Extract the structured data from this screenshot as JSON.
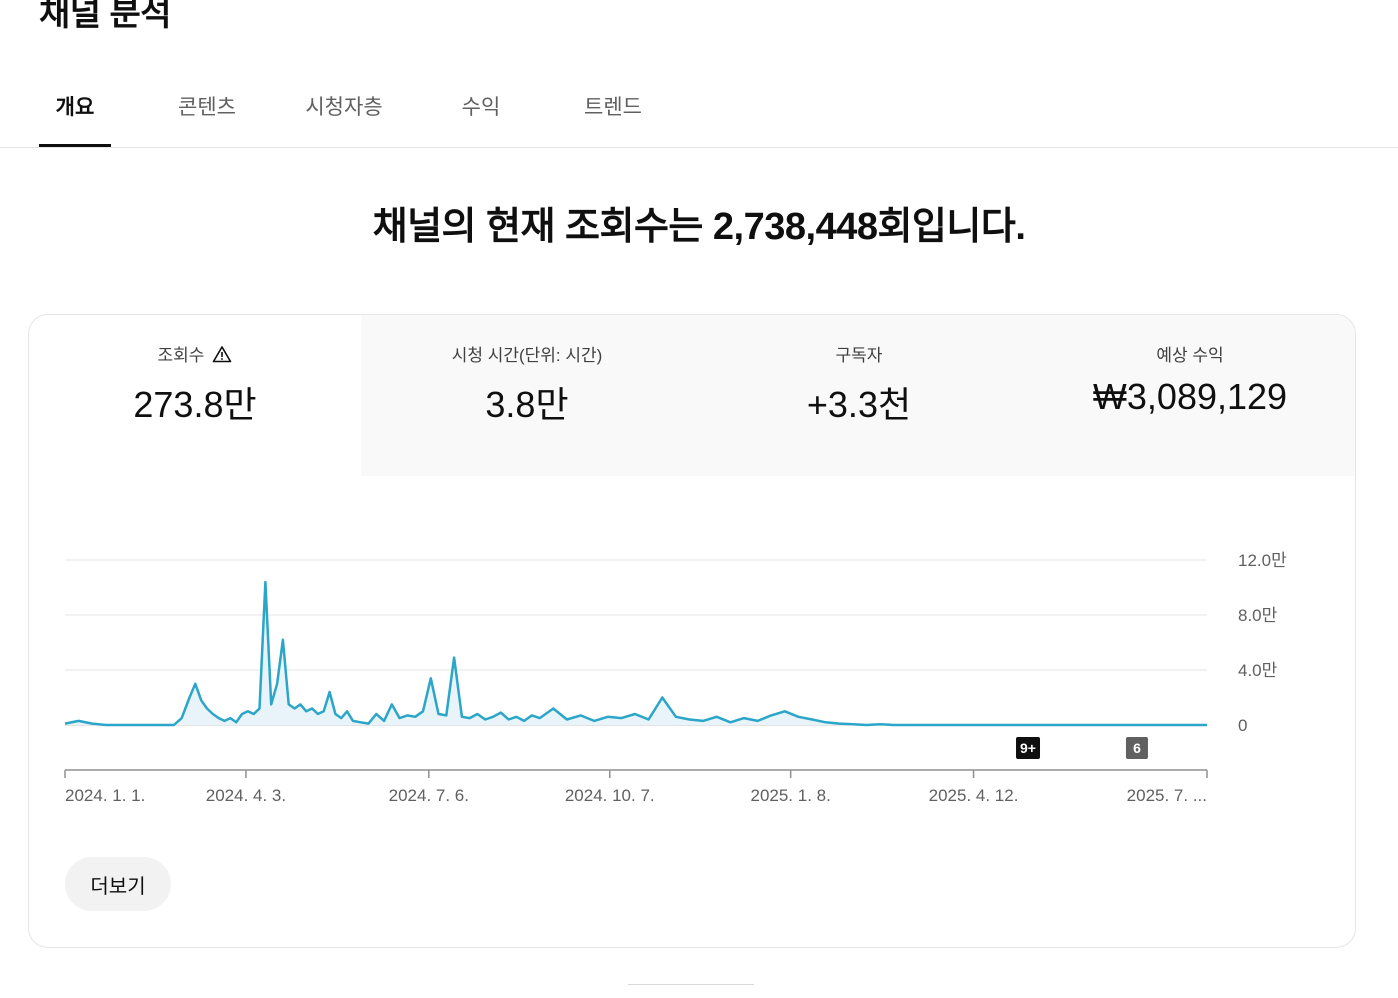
{
  "page_title": "채널 분석",
  "tabs": [
    {
      "label": "개요",
      "active": true
    },
    {
      "label": "콘텐츠",
      "active": false
    },
    {
      "label": "시청자층",
      "active": false
    },
    {
      "label": "수익",
      "active": false
    },
    {
      "label": "트렌드",
      "active": false
    }
  ],
  "headline": "채널의 현재 조회수는 2,738,448회입니다.",
  "metrics": [
    {
      "label": "조회수",
      "value": "273.8만",
      "icon": "warning-icon",
      "active": true
    },
    {
      "label": "시청 시간(단위: 시간)",
      "value": "3.8만",
      "active": false
    },
    {
      "label": "구독자",
      "value": "+3.3천",
      "active": false
    },
    {
      "label": "예상 수익",
      "value": "₩3,089,129",
      "active": false
    }
  ],
  "more_button": "더보기",
  "colors": {
    "line": "#2ba5c8",
    "fill": "#e8f4f9",
    "active_tab": "#0f0f0f"
  },
  "chart_data": {
    "type": "line",
    "series": [
      {
        "x": [
          "2024-01-01",
          "2024-01-08",
          "2024-01-15",
          "2024-01-22",
          "2024-01-29",
          "2024-02-05",
          "2024-02-12",
          "2024-02-19",
          "2024-02-26",
          "2024-03-01",
          "2024-03-05",
          "2024-03-08",
          "2024-03-11",
          "2024-03-14",
          "2024-03-17",
          "2024-03-20",
          "2024-03-23",
          "2024-03-26",
          "2024-03-29",
          "2024-04-01",
          "2024-04-04",
          "2024-04-07",
          "2024-04-10",
          "2024-04-13",
          "2024-04-16",
          "2024-04-19",
          "2024-04-22",
          "2024-04-25",
          "2024-04-28",
          "2024-05-01",
          "2024-05-04",
          "2024-05-07",
          "2024-05-10",
          "2024-05-13",
          "2024-05-16",
          "2024-05-19",
          "2024-05-22",
          "2024-05-25",
          "2024-05-28",
          "2024-06-01",
          "2024-06-05",
          "2024-06-09",
          "2024-06-13",
          "2024-06-17",
          "2024-06-21",
          "2024-06-25",
          "2024-06-29",
          "2024-07-03",
          "2024-07-07",
          "2024-07-11",
          "2024-07-15",
          "2024-07-19",
          "2024-07-23",
          "2024-07-27",
          "2024-07-31",
          "2024-08-04",
          "2024-08-08",
          "2024-08-12",
          "2024-08-16",
          "2024-08-20",
          "2024-08-24",
          "2024-08-28",
          "2024-09-01",
          "2024-09-08",
          "2024-09-15",
          "2024-09-22",
          "2024-09-29",
          "2024-10-06",
          "2024-10-13",
          "2024-10-20",
          "2024-10-27",
          "2024-11-03",
          "2024-11-10",
          "2024-11-17",
          "2024-11-24",
          "2024-12-01",
          "2024-12-08",
          "2024-12-15",
          "2024-12-22",
          "2024-12-29",
          "2025-01-05",
          "2025-01-12",
          "2025-01-19",
          "2025-01-26",
          "2025-02-02",
          "2025-02-09",
          "2025-02-16",
          "2025-02-23",
          "2025-03-02",
          "2025-03-16",
          "2025-03-30",
          "2025-04-13",
          "2025-05-01",
          "2025-05-20",
          "2025-06-10",
          "2025-07-01",
          "2025-07-20",
          "2025-08-10"
        ],
        "y": [
          1000,
          3000,
          1000,
          0,
          0,
          0,
          0,
          0,
          0,
          5000,
          20000,
          30000,
          18000,
          12000,
          8000,
          5000,
          3000,
          5000,
          2000,
          8000,
          10000,
          8000,
          12000,
          104000,
          15000,
          30000,
          62000,
          15000,
          12000,
          15000,
          10000,
          12000,
          8000,
          10000,
          24000,
          8000,
          5000,
          10000,
          3000,
          2000,
          1000,
          8000,
          3000,
          15000,
          5000,
          7000,
          6000,
          10000,
          34000,
          8000,
          7000,
          49000,
          6000,
          5000,
          8000,
          4000,
          6000,
          9000,
          4000,
          6000,
          3000,
          7000,
          5000,
          12000,
          4000,
          7000,
          3000,
          6000,
          5000,
          8000,
          4000,
          20000,
          6000,
          4000,
          3000,
          6000,
          2000,
          5000,
          3000,
          7000,
          10000,
          6000,
          4000,
          2000,
          1000,
          500,
          0,
          500,
          0,
          0,
          0,
          0,
          0,
          0,
          0,
          0,
          0,
          0
        ]
      }
    ],
    "x_tick_labels": [
      "2024. 1. 1.",
      "2024. 4. 3.",
      "2024. 7. 6.",
      "2024. 10. 7.",
      "2025. 1. 8.",
      "2025. 4. 12.",
      "2025. 7. ..."
    ],
    "x_ticks": [
      "2024-01-01",
      "2024-04-03",
      "2024-07-06",
      "2024-10-07",
      "2025-01-08",
      "2025-04-12",
      "2025-07-15"
    ],
    "xlim": [
      "2024-01-01",
      "2025-08-10"
    ],
    "y_tick_labels": [
      "12.0만",
      "8.0만",
      "4.0만",
      "0"
    ],
    "y_ticks": [
      120000,
      80000,
      40000,
      0
    ],
    "ylim": [
      0,
      120000
    ],
    "axis_side": "right",
    "grid": true,
    "markers": [
      {
        "label": "9+",
        "date": "2025-05-10",
        "color": "#0f0f0f"
      },
      {
        "label": "6",
        "date": "2025-07-05",
        "color": "#606060"
      }
    ]
  }
}
